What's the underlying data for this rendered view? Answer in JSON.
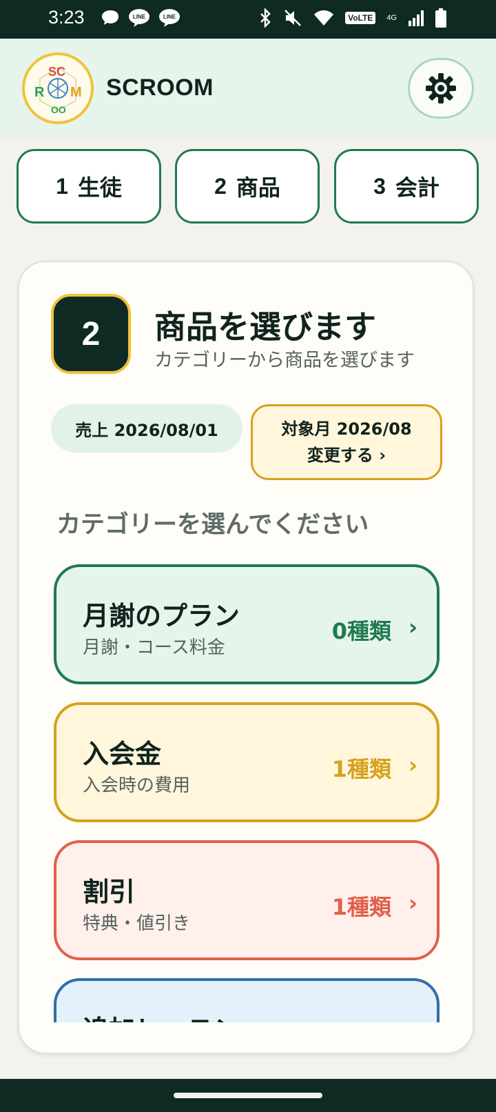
{
  "status_bar": {
    "time": "3:23",
    "volte": "VoLTE",
    "network": "4G",
    "left_icons": [
      "chat-bubble-icon",
      "line-app-icon",
      "line-app-icon"
    ],
    "right_icons": [
      "bluetooth-icon",
      "mute-icon",
      "wifi-icon",
      "signal-icon",
      "battery-icon"
    ]
  },
  "header": {
    "app_name": "SCROOM",
    "logo_text": "SCROOM",
    "settings_icon": "gear-icon"
  },
  "steps": [
    {
      "number": "1",
      "label": "生徒"
    },
    {
      "number": "2",
      "label": "商品"
    },
    {
      "number": "3",
      "label": "会計"
    }
  ],
  "main": {
    "step_number": "2",
    "title": "商品を選びます",
    "subtitle": "カテゴリーから商品を選びます",
    "sales_date": "売上 2026/08/01",
    "target_month": "対象月 2026/08",
    "change_label": "変更する ›",
    "prompt": "カテゴリーを選んでください",
    "categories": [
      {
        "title": "月謝のプラン",
        "desc": "月謝・コース料金",
        "count": "0種類",
        "color": "#1f7a4f"
      },
      {
        "title": "入会金",
        "desc": "入会時の費用",
        "count": "1種類",
        "color": "#d6a21e"
      },
      {
        "title": "割引",
        "desc": "特典・値引き",
        "count": "1種類",
        "color": "#e0604a"
      },
      {
        "title": "追加レッスン",
        "desc": "",
        "count": "",
        "color": "#2f6fa8"
      }
    ],
    "chevron": "›"
  }
}
